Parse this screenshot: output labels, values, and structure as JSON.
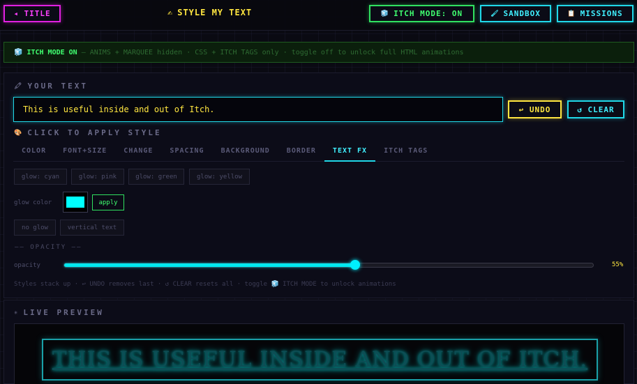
{
  "header": {
    "title_button": "◂ TITLE",
    "app_title_icon": "✍",
    "app_title": "STYLE MY TEXT",
    "itch_mode_button": "ITCH MODE: ON",
    "itch_icon": "🧊",
    "sandbox_icon": "🖌",
    "sandbox_button": "SANDBOX",
    "missions_icon": "📋",
    "missions_button": "MISSIONS"
  },
  "banner": {
    "icon": "🧊",
    "status": "ITCH MODE ON",
    "message": "— ANIMS + MARQUEE hidden · CSS + ITCH TAGS only · toggle off to unlock full HTML animations"
  },
  "editor": {
    "your_text_icon": "🖍",
    "your_text_label": "YOUR TEXT",
    "text_value": "This is useful inside and out of Itch.",
    "undo_button": "↩ UNDO",
    "clear_button": "↺ CLEAR",
    "apply_style_icon": "🎨",
    "apply_style_label": "CLICK TO APPLY STYLE"
  },
  "tabs": [
    "COLOR",
    "FONT+SIZE",
    "CHANGE",
    "SPACING",
    "BACKGROUND",
    "BORDER",
    "TEXT FX",
    "ITCH TAGS"
  ],
  "active_tab": "TEXT FX",
  "text_fx": {
    "glow_chips": [
      "glow: cyan",
      "glow: pink",
      "glow: green",
      "glow: yellow"
    ],
    "glow_color_label": "glow color",
    "glow_color_value": "#00ffff",
    "apply_button": "apply",
    "no_glow_button": "no glow",
    "vertical_text_button": "vertical text",
    "opacity_heading": "—— OPACITY ——",
    "opacity_label": "opacity",
    "opacity_value": 0.55,
    "opacity_display": "55%",
    "hint": "Styles stack up · ↩ UNDO removes last · ↺ CLEAR resets all · toggle 🧊 ITCH MODE to unlock animations"
  },
  "preview": {
    "icon": "✳",
    "label": "LIVE PREVIEW",
    "text": "This is useful inside and out of Itch."
  },
  "colors": {
    "cyan": "#20d8e8",
    "magenta": "#e020e0",
    "green": "#30e060",
    "yellow": "#ffe640",
    "background": "#0a0a12"
  }
}
